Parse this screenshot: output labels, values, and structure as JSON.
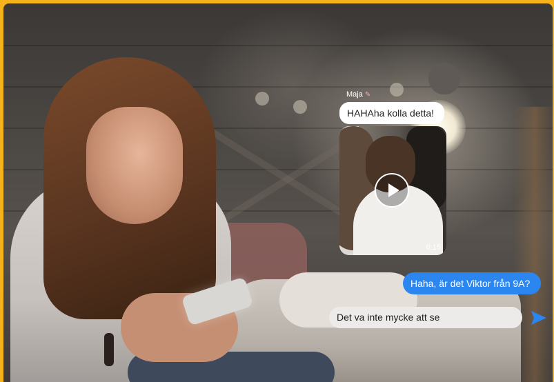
{
  "chat": {
    "sender_name": "Maja",
    "sender_emoji": "nail-polish-icon",
    "incoming_message": "HAHAha kolla detta!",
    "video": {
      "duration": "0:15",
      "play_icon": "play-icon"
    },
    "outgoing_message": "Haha, är det Viktor från 9A?",
    "composer_text": "Det va inte mycke att se",
    "send_icon": "send-icon"
  },
  "colors": {
    "frame": "#f5b21a",
    "outgoing_bubble": "#2b86ef",
    "incoming_bubble": "#ffffff",
    "composer": "#ecebea",
    "send_icon": "#2b86ef"
  }
}
